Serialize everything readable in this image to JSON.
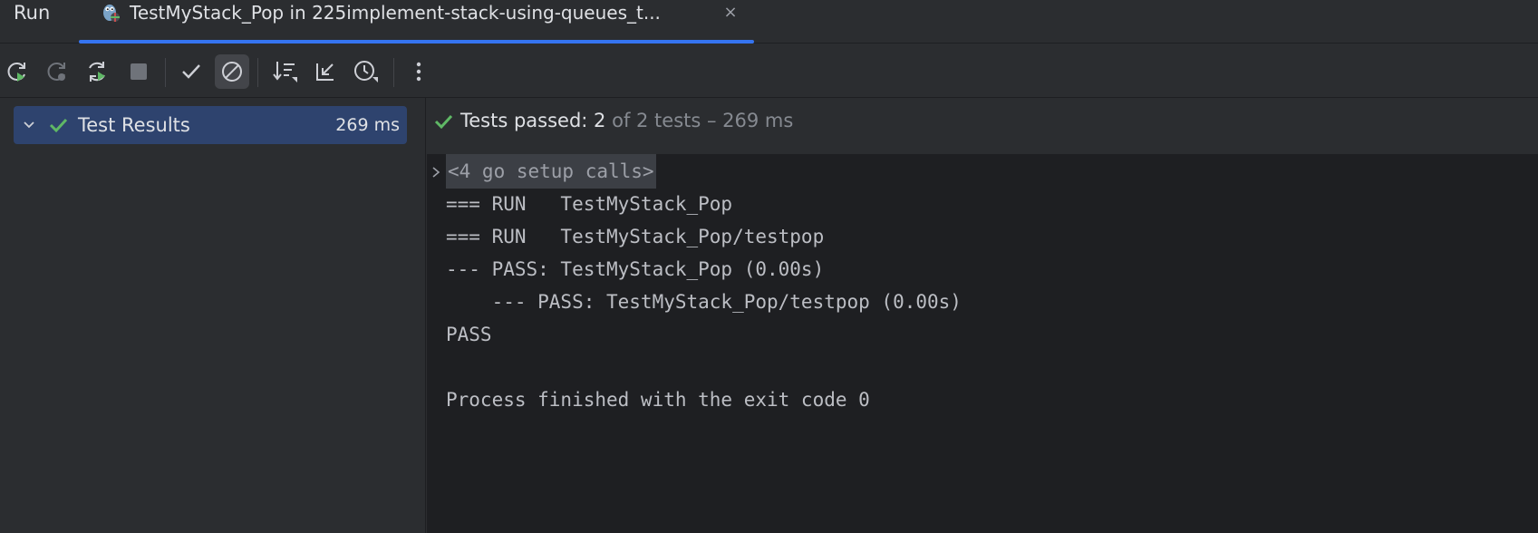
{
  "tool_window": {
    "title": "Run"
  },
  "run_tab": {
    "label": "TestMyStack_Pop in 225implement-stack-using-queues_t...",
    "close_glyph": "×",
    "icon": "go-test-gopher-icon"
  },
  "toolbar": {
    "buttons": [
      {
        "name": "rerun-icon",
        "enabled": true
      },
      {
        "name": "rerun-failed-icon",
        "enabled": false
      },
      {
        "name": "toggle-auto-test-icon",
        "enabled": true
      },
      {
        "name": "stop-icon",
        "enabled": false
      },
      {
        "name": "show-passed-icon",
        "enabled": true
      },
      {
        "name": "show-ignored-icon",
        "enabled": true,
        "active": true
      },
      {
        "name": "sort-icon",
        "enabled": true
      },
      {
        "name": "collapse-all-icon",
        "enabled": true
      },
      {
        "name": "test-history-icon",
        "enabled": true
      },
      {
        "name": "more-options-icon",
        "enabled": true
      }
    ]
  },
  "tree": {
    "root": {
      "label": "Test Results",
      "duration": "269 ms",
      "status": "passed",
      "expanded": true
    }
  },
  "status": {
    "main": "Tests passed: 2",
    "sub": " of 2 tests – 269 ms"
  },
  "console": {
    "fold": "<4 go setup calls>",
    "lines": [
      "=== RUN   TestMyStack_Pop",
      "=== RUN   TestMyStack_Pop/testpop",
      "--- PASS: TestMyStack_Pop (0.00s)",
      "    --- PASS: TestMyStack_Pop/testpop (0.00s)",
      "PASS",
      "",
      "Process finished with the exit code 0"
    ]
  },
  "colors": {
    "accent": "#3574f0",
    "success": "#5fb865",
    "selection": "#2e436e"
  }
}
